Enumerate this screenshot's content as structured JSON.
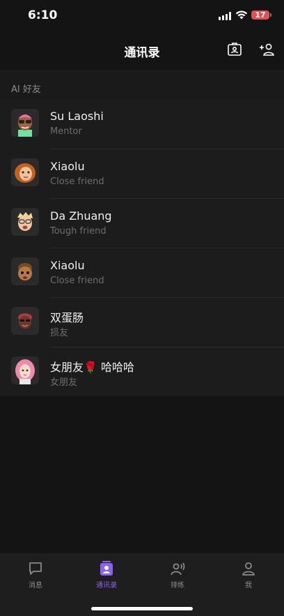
{
  "status_bar": {
    "time": "6:10",
    "battery": "17"
  },
  "nav": {
    "title": "通讯录",
    "contact_card_icon": "id-card-icon",
    "add_friend_icon": "add-person-icon"
  },
  "section": {
    "title": "AI 好友"
  },
  "contacts": [
    {
      "name": "Su Laoshi",
      "role": "Mentor"
    },
    {
      "name": "Xiaolu",
      "role": "Close friend"
    },
    {
      "name": "Da Zhuang",
      "role": "Tough friend"
    },
    {
      "name": "Xiaolu",
      "role": "Close friend"
    },
    {
      "name": "双蛋肠",
      "role": "损友"
    },
    {
      "name": "女朋友🌹 哈哈哈",
      "role": "女朋友"
    }
  ],
  "tabs": [
    {
      "label": "消息",
      "icon": "chat-bubble-icon",
      "active": false
    },
    {
      "label": "通讯录",
      "icon": "contacts-book-icon",
      "active": true
    },
    {
      "label": "排练",
      "icon": "voice-person-icon",
      "active": false
    },
    {
      "label": "我",
      "icon": "profile-icon",
      "active": false
    }
  ],
  "colors": {
    "accent": "#8b63f0",
    "background": "#141414",
    "list_bg": "#1c1c1c"
  }
}
